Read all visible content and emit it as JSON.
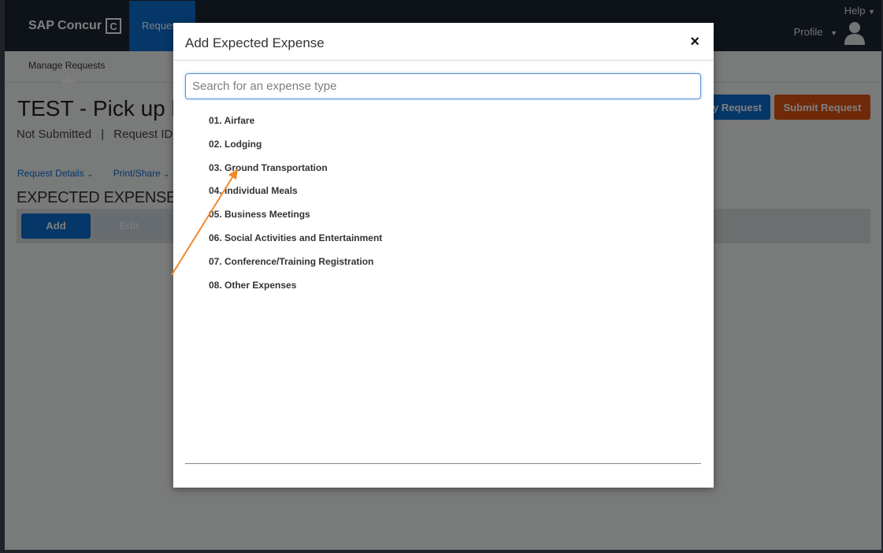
{
  "topnav": {
    "logo_text": "SAP Concur",
    "logo_mark": "C",
    "active_tab": "Requests",
    "help_label": "Help",
    "profile_label": "Profile"
  },
  "subnav": {
    "manage_requests": "Manage Requests"
  },
  "request": {
    "title": "TEST - Pick up l",
    "status": "Not Submitted",
    "separator": "|",
    "request_id_label": "Request ID:",
    "copy_button": "y Request",
    "submit_button": "Submit Request",
    "tabs": [
      {
        "label": "Request Details"
      },
      {
        "label": "Print/Share"
      }
    ],
    "section_title": "EXPECTED EXPENSES",
    "add_button": "Add",
    "edit_button": "Edit"
  },
  "modal": {
    "title": "Add Expected Expense",
    "close_label": "×",
    "search_placeholder": "Search for an expense type",
    "expense_types": [
      "01. Airfare",
      "02. Lodging",
      "03. Ground Transportation",
      "04. Individual Meals",
      "05. Business Meetings",
      "06. Social Activities and Entertainment",
      "07. Conference/Training Registration",
      "08. Other Expenses"
    ]
  },
  "colors": {
    "nav_bg": "#1d2735",
    "primary_blue": "#0a6ed1",
    "submit_orange": "#e05412",
    "annotation_arrow": "#f0882c"
  }
}
